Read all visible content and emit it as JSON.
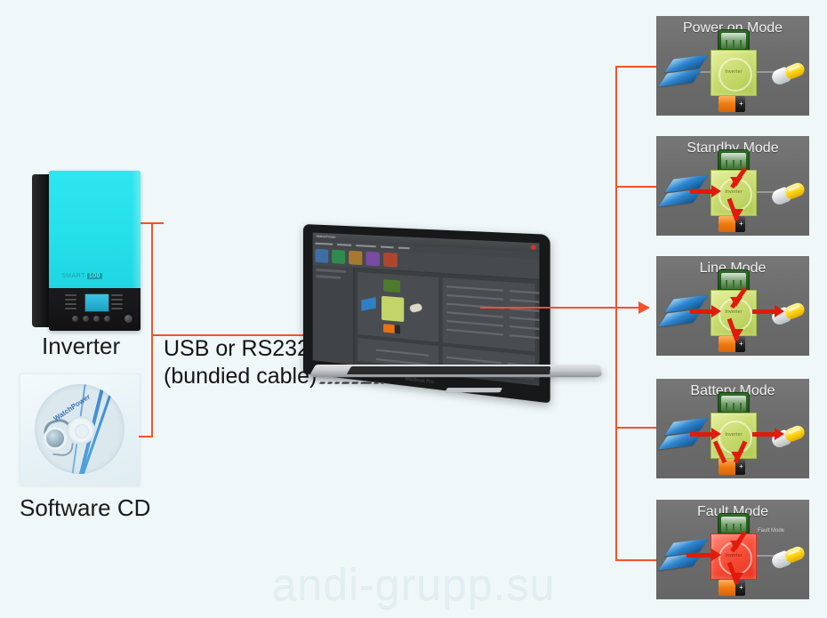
{
  "page": {
    "background_color": "#eff7f9",
    "watermark": "andi-grupp.su",
    "accent_color": "#f9502a",
    "flow_color": "#e01b0c",
    "panel_color": "#6e6e6e"
  },
  "left_column": {
    "inverter": {
      "caption": "Inverter",
      "brand": "SMART",
      "brand_badge": "100"
    },
    "software_cd": {
      "caption": "Software CD",
      "disc_logo": "WatchPower"
    }
  },
  "connection": {
    "label_line1": "USB or RS232",
    "label_line2": "(bundied cable)"
  },
  "laptop": {
    "app_title": "WatchPower",
    "apple_mark": "MacBook Pro"
  },
  "modes": [
    {
      "title": "Power on Mode",
      "inverter_label": "Inverter",
      "inverter_state": "normal",
      "flows": [],
      "note": ""
    },
    {
      "title": "Standby Mode",
      "inverter_label": "Inverter",
      "inverter_state": "normal",
      "flows": [
        "solar-to-inverter",
        "grid-to-inverter",
        "inverter-to-battery"
      ],
      "note": ""
    },
    {
      "title": "Line Mode",
      "inverter_label": "Inverter",
      "inverter_state": "normal",
      "flows": [
        "solar-to-inverter",
        "grid-to-inverter",
        "inverter-to-battery",
        "inverter-to-load"
      ],
      "note": ""
    },
    {
      "title": "Battery Mode",
      "inverter_label": "Inverter",
      "inverter_state": "normal",
      "flows": [
        "solar-to-inverter",
        "battery-to-inverter",
        "inverter-to-load"
      ],
      "note": ""
    },
    {
      "title": "Fault Mode",
      "inverter_label": "Inverter",
      "inverter_state": "fault",
      "flows": [
        "solar-to-inverter",
        "grid-to-inverter",
        "inverter-to-battery"
      ],
      "note": "Fault Mode"
    }
  ],
  "mode_icons": {
    "grid": "utility-grid-icon",
    "solar": "solar-panel-icon",
    "battery": "battery-icon",
    "load": "light-bulb-icon",
    "inverter": "inverter-icon"
  }
}
